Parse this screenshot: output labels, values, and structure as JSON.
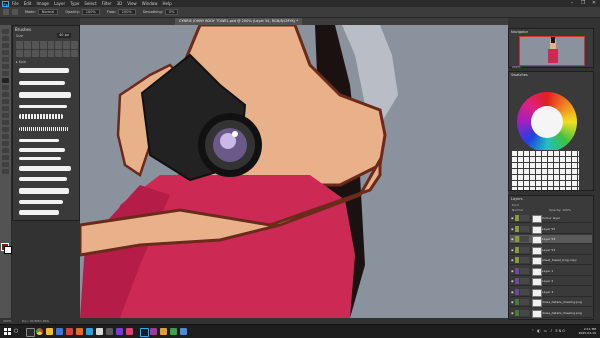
{
  "menubar": {
    "app_logo": "Ps",
    "items": [
      "File",
      "Edit",
      "Image",
      "Layer",
      "Type",
      "Select",
      "Filter",
      "3D",
      "View",
      "Window",
      "Help"
    ],
    "window_controls": [
      "–",
      "❐",
      "✕"
    ]
  },
  "optionsbar": {
    "mode_label": "Mode:",
    "mode_value": "Normal",
    "opacity_label": "Opacity:",
    "opacity_value": "100%",
    "flow_label": "Flow:",
    "flow_value": "100%",
    "smoothing_label": "Smoothing:",
    "smoothing_value": "0%"
  },
  "document": {
    "tab_title": "CYNRIE JOHNY BODY TOWEL.psd @ 200% (Layer 54, RGB/8/CMYK) *"
  },
  "brush_panel": {
    "title": "Brushes",
    "size_label": "Size",
    "size_value": "40 px",
    "folder_label": "▸ Kyle"
  },
  "navigator": {
    "title": "Navigator",
    "zoom": "200%"
  },
  "swatches": {
    "title": "Swatches"
  },
  "layers": {
    "title": "Layers",
    "kind_label": "Kind",
    "blend_label": "Normal",
    "opacity_label": "Opacity: 100%",
    "rows": [
      {
        "name": "Colour layer",
        "color": "#8a9a3a",
        "selected": false
      },
      {
        "name": "Layer 55",
        "color": "#8a9a3a",
        "selected": false
      },
      {
        "name": "Layer 54",
        "color": "#8a9a3a",
        "selected": true
      },
      {
        "name": "Layer 53",
        "color": "#8a9a3a",
        "selected": false
      },
      {
        "name": "sheet_tassel_long copy",
        "color": "#8a9a3a",
        "selected": false
      },
      {
        "name": "Layer 1",
        "color": "#6a4a9a",
        "selected": false
      },
      {
        "name": "Layer 2",
        "color": "#6a4a9a",
        "selected": false
      },
      {
        "name": "Layer 3",
        "color": "#6a4a9a",
        "selected": false
      },
      {
        "name": "dress_details_drawing.png",
        "color": "#4a7a3a",
        "selected": false
      },
      {
        "name": "dress_details_drawing.png",
        "color": "#4a7a3a",
        "selected": false
      }
    ]
  },
  "statusbar": {
    "zoom": "200%",
    "doc_info": "Doc: 40.8M/1.89G"
  },
  "taskbar": {
    "search_glyph": "○",
    "tray_icons": "⌃ ◧ ▭ ♪ ENG",
    "time": "2:11 PM",
    "date": "2025-03-19"
  },
  "colors": {
    "canvas_bg": "#8a929d",
    "skin": "#e8b18a",
    "dress": "#cc2a55",
    "hair": "#1a1210",
    "camera_body": "#222222"
  }
}
